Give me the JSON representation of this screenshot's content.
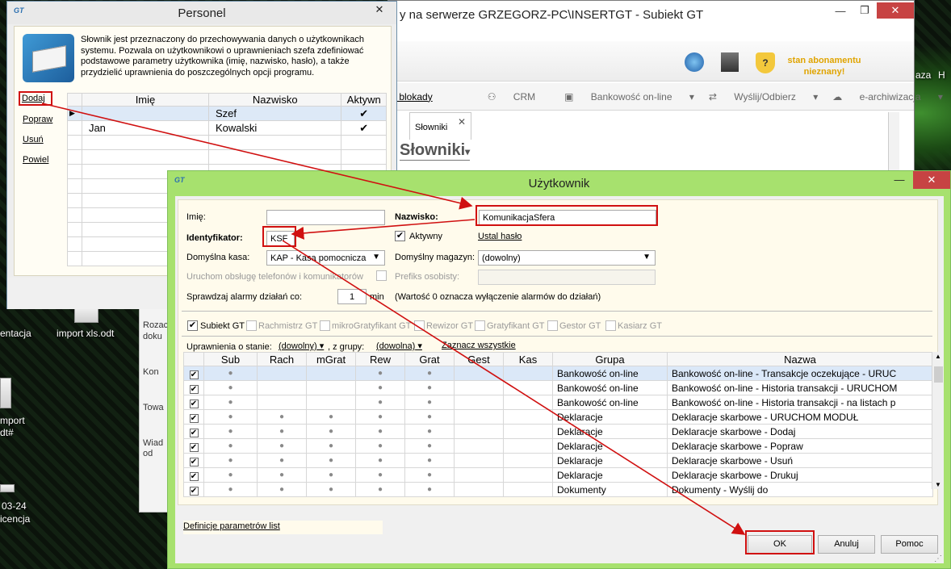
{
  "desktop": {
    "items": [
      "entacja",
      "import xls.odt",
      "mport",
      "dt#",
      "03-24",
      "icencja",
      "aza",
      "H"
    ]
  },
  "bg_app": {
    "title": "y na serwerze GRZEGORZ-PC\\INSERTGT - Subiekt GT",
    "subscription": "stan abonamentu nieznany!",
    "toolbar": {
      "blokady": "k blokady",
      "crm": "CRM",
      "bank": "Bankowość on-line",
      "wyslij": "Wyślij/Odbierz",
      "earch": "e-archiwizacja"
    },
    "tab": "Słowniki",
    "heading": "Słowniki",
    "frag": [
      "Rozac",
      "doku",
      "Kon",
      "Towa",
      "Wiad",
      "od"
    ]
  },
  "personel": {
    "title": "Personel",
    "description": "Słownik jest przeznaczony do przechowywania danych o użytkownikach systemu. Pozwala on użytkownikowi o uprawnieniach szefa zdefiniować podstawowe parametry użytkownika (imię, nazwisko, hasło), a także przydzielić uprawnienia do poszczególnych opcji programu.",
    "links": {
      "add": "Dodaj",
      "edit": "Popraw",
      "remove": "Usuń",
      "copy": "Powiel"
    },
    "columns": {
      "imie": "Imię",
      "nazwisko": "Nazwisko",
      "aktywny": "Aktywn"
    },
    "rows": [
      {
        "imie": "",
        "nazwisko": "Szef",
        "aktywny": "✔"
      },
      {
        "imie": "Jan",
        "nazwisko": "Kowalski",
        "aktywny": "✔"
      }
    ]
  },
  "uzytkownik": {
    "title": "Użytkownik",
    "labels": {
      "imie": "Imię:",
      "nazwisko": "Nazwisko:",
      "identyfikator": "Identyfikator:",
      "aktywny": "Aktywny",
      "ustal_haslo": "Ustal hasło",
      "kasa": "Domyślna kasa:",
      "magazyn": "Domyślny magazyn:",
      "uruchom": "Uruchom obsługę telefonów i komunikatorów",
      "prefiks": "Prefiks osobisty:",
      "alarmy": "Sprawdzaj alarmy działań co:",
      "min": "min",
      "alarmy_info": "(Wartość 0 oznacza wyłączenie alarmów do działań)",
      "uprawnienia": "Uprawnienia o stanie:",
      "z_grupy": ", z grupy:",
      "zaznacz": "Zaznacz wszystkie",
      "definicje": "Definicje parametrów list"
    },
    "values": {
      "imie": "",
      "nazwisko": "KomunikacjaSfera",
      "identyfikator": "KSF",
      "kasa": "KAP - Kasa pomocnicza",
      "magazyn": "(dowolny)",
      "prefiks": "",
      "alarmy": "1",
      "stan": "(dowolny)",
      "grupa": "(dowolna)"
    },
    "modules": [
      "Subiekt GT",
      "Rachmistrz GT",
      "mikroGratyfikant GT",
      "Rewizor GT",
      "Gratyfikant GT",
      "Gestor GT",
      "Kasiarz GT"
    ],
    "columns": [
      "Sub",
      "Rach",
      "mGrat",
      "Rew",
      "Grat",
      "Gest",
      "Kas",
      "Grupa",
      "Nazwa"
    ],
    "rows": [
      {
        "cols": [
          1,
          0,
          0,
          1,
          1,
          0,
          0
        ],
        "grupa": "Bankowość on-line",
        "nazwa": "Bankowość on-line - Transakcje oczekujące - URUC"
      },
      {
        "cols": [
          1,
          0,
          0,
          1,
          1,
          0,
          0
        ],
        "grupa": "Bankowość on-line",
        "nazwa": "Bankowość on-line - Historia transakcji - URUCHOM"
      },
      {
        "cols": [
          1,
          0,
          0,
          1,
          1,
          0,
          0
        ],
        "grupa": "Bankowość on-line",
        "nazwa": "Bankowość on-line - Historia transakcji - na listach p"
      },
      {
        "cols": [
          1,
          1,
          1,
          1,
          1,
          0,
          0
        ],
        "grupa": "Deklaracje",
        "nazwa": "Deklaracje skarbowe - URUCHOM MODUŁ"
      },
      {
        "cols": [
          1,
          1,
          1,
          1,
          1,
          0,
          0
        ],
        "grupa": "Deklaracje",
        "nazwa": "Deklaracje skarbowe - Dodaj"
      },
      {
        "cols": [
          1,
          1,
          1,
          1,
          1,
          0,
          0
        ],
        "grupa": "Deklaracje",
        "nazwa": "Deklaracje skarbowe - Popraw"
      },
      {
        "cols": [
          1,
          1,
          1,
          1,
          1,
          0,
          0
        ],
        "grupa": "Deklaracje",
        "nazwa": "Deklaracje skarbowe - Usuń"
      },
      {
        "cols": [
          1,
          1,
          1,
          1,
          1,
          0,
          0
        ],
        "grupa": "Deklaracje",
        "nazwa": "Deklaracje skarbowe - Drukuj"
      },
      {
        "cols": [
          1,
          1,
          1,
          1,
          1,
          0,
          0
        ],
        "grupa": "Dokumenty",
        "nazwa": "Dokumenty - Wyślij do"
      }
    ],
    "buttons": {
      "ok": "OK",
      "cancel": "Anuluj",
      "help": "Pomoc"
    }
  },
  "colors": {
    "highlight": "#d01010",
    "dialog_frame": "#a7e16e",
    "subscription": "#e0a400"
  }
}
